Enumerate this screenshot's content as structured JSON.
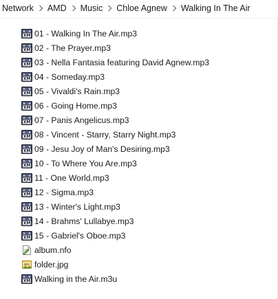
{
  "breadcrumb": {
    "items": [
      "Network",
      "AMD",
      "Music",
      "Chloe Agnew",
      "Walking In The Air"
    ]
  },
  "files": [
    {
      "name": "01 - Walking In The Air.mp3",
      "icon": "audio-file-icon"
    },
    {
      "name": "02 - The Prayer.mp3",
      "icon": "audio-file-icon"
    },
    {
      "name": "03 - Nella Fantasia featuring David Agnew.mp3",
      "icon": "audio-file-icon"
    },
    {
      "name": "04 - Someday.mp3",
      "icon": "audio-file-icon"
    },
    {
      "name": "05 - Vivaldi's Rain.mp3",
      "icon": "audio-file-icon"
    },
    {
      "name": "06 - Going Home.mp3",
      "icon": "audio-file-icon"
    },
    {
      "name": "07 - Panis Angelicus.mp3",
      "icon": "audio-file-icon"
    },
    {
      "name": "08 - Vincent - Starry, Starry Night.mp3",
      "icon": "audio-file-icon"
    },
    {
      "name": "09 - Jesu Joy of Man's Desiring.mp3",
      "icon": "audio-file-icon"
    },
    {
      "name": "10 - To Where You Are.mp3",
      "icon": "audio-file-icon"
    },
    {
      "name": "11 - One World.mp3",
      "icon": "audio-file-icon"
    },
    {
      "name": "12 - Sigma.mp3",
      "icon": "audio-file-icon"
    },
    {
      "name": "13 - Winter's Light.mp3",
      "icon": "audio-file-icon"
    },
    {
      "name": "14 - Brahms' Lullabye.mp3",
      "icon": "audio-file-icon"
    },
    {
      "name": "15 - Gabriel's Oboe.mp3",
      "icon": "audio-file-icon"
    },
    {
      "name": "album.nfo",
      "icon": "info-file-icon"
    },
    {
      "name": "folder.jpg",
      "icon": "image-file-icon"
    },
    {
      "name": "Walking in the Air.m3u",
      "icon": "playlist-file-icon"
    }
  ]
}
